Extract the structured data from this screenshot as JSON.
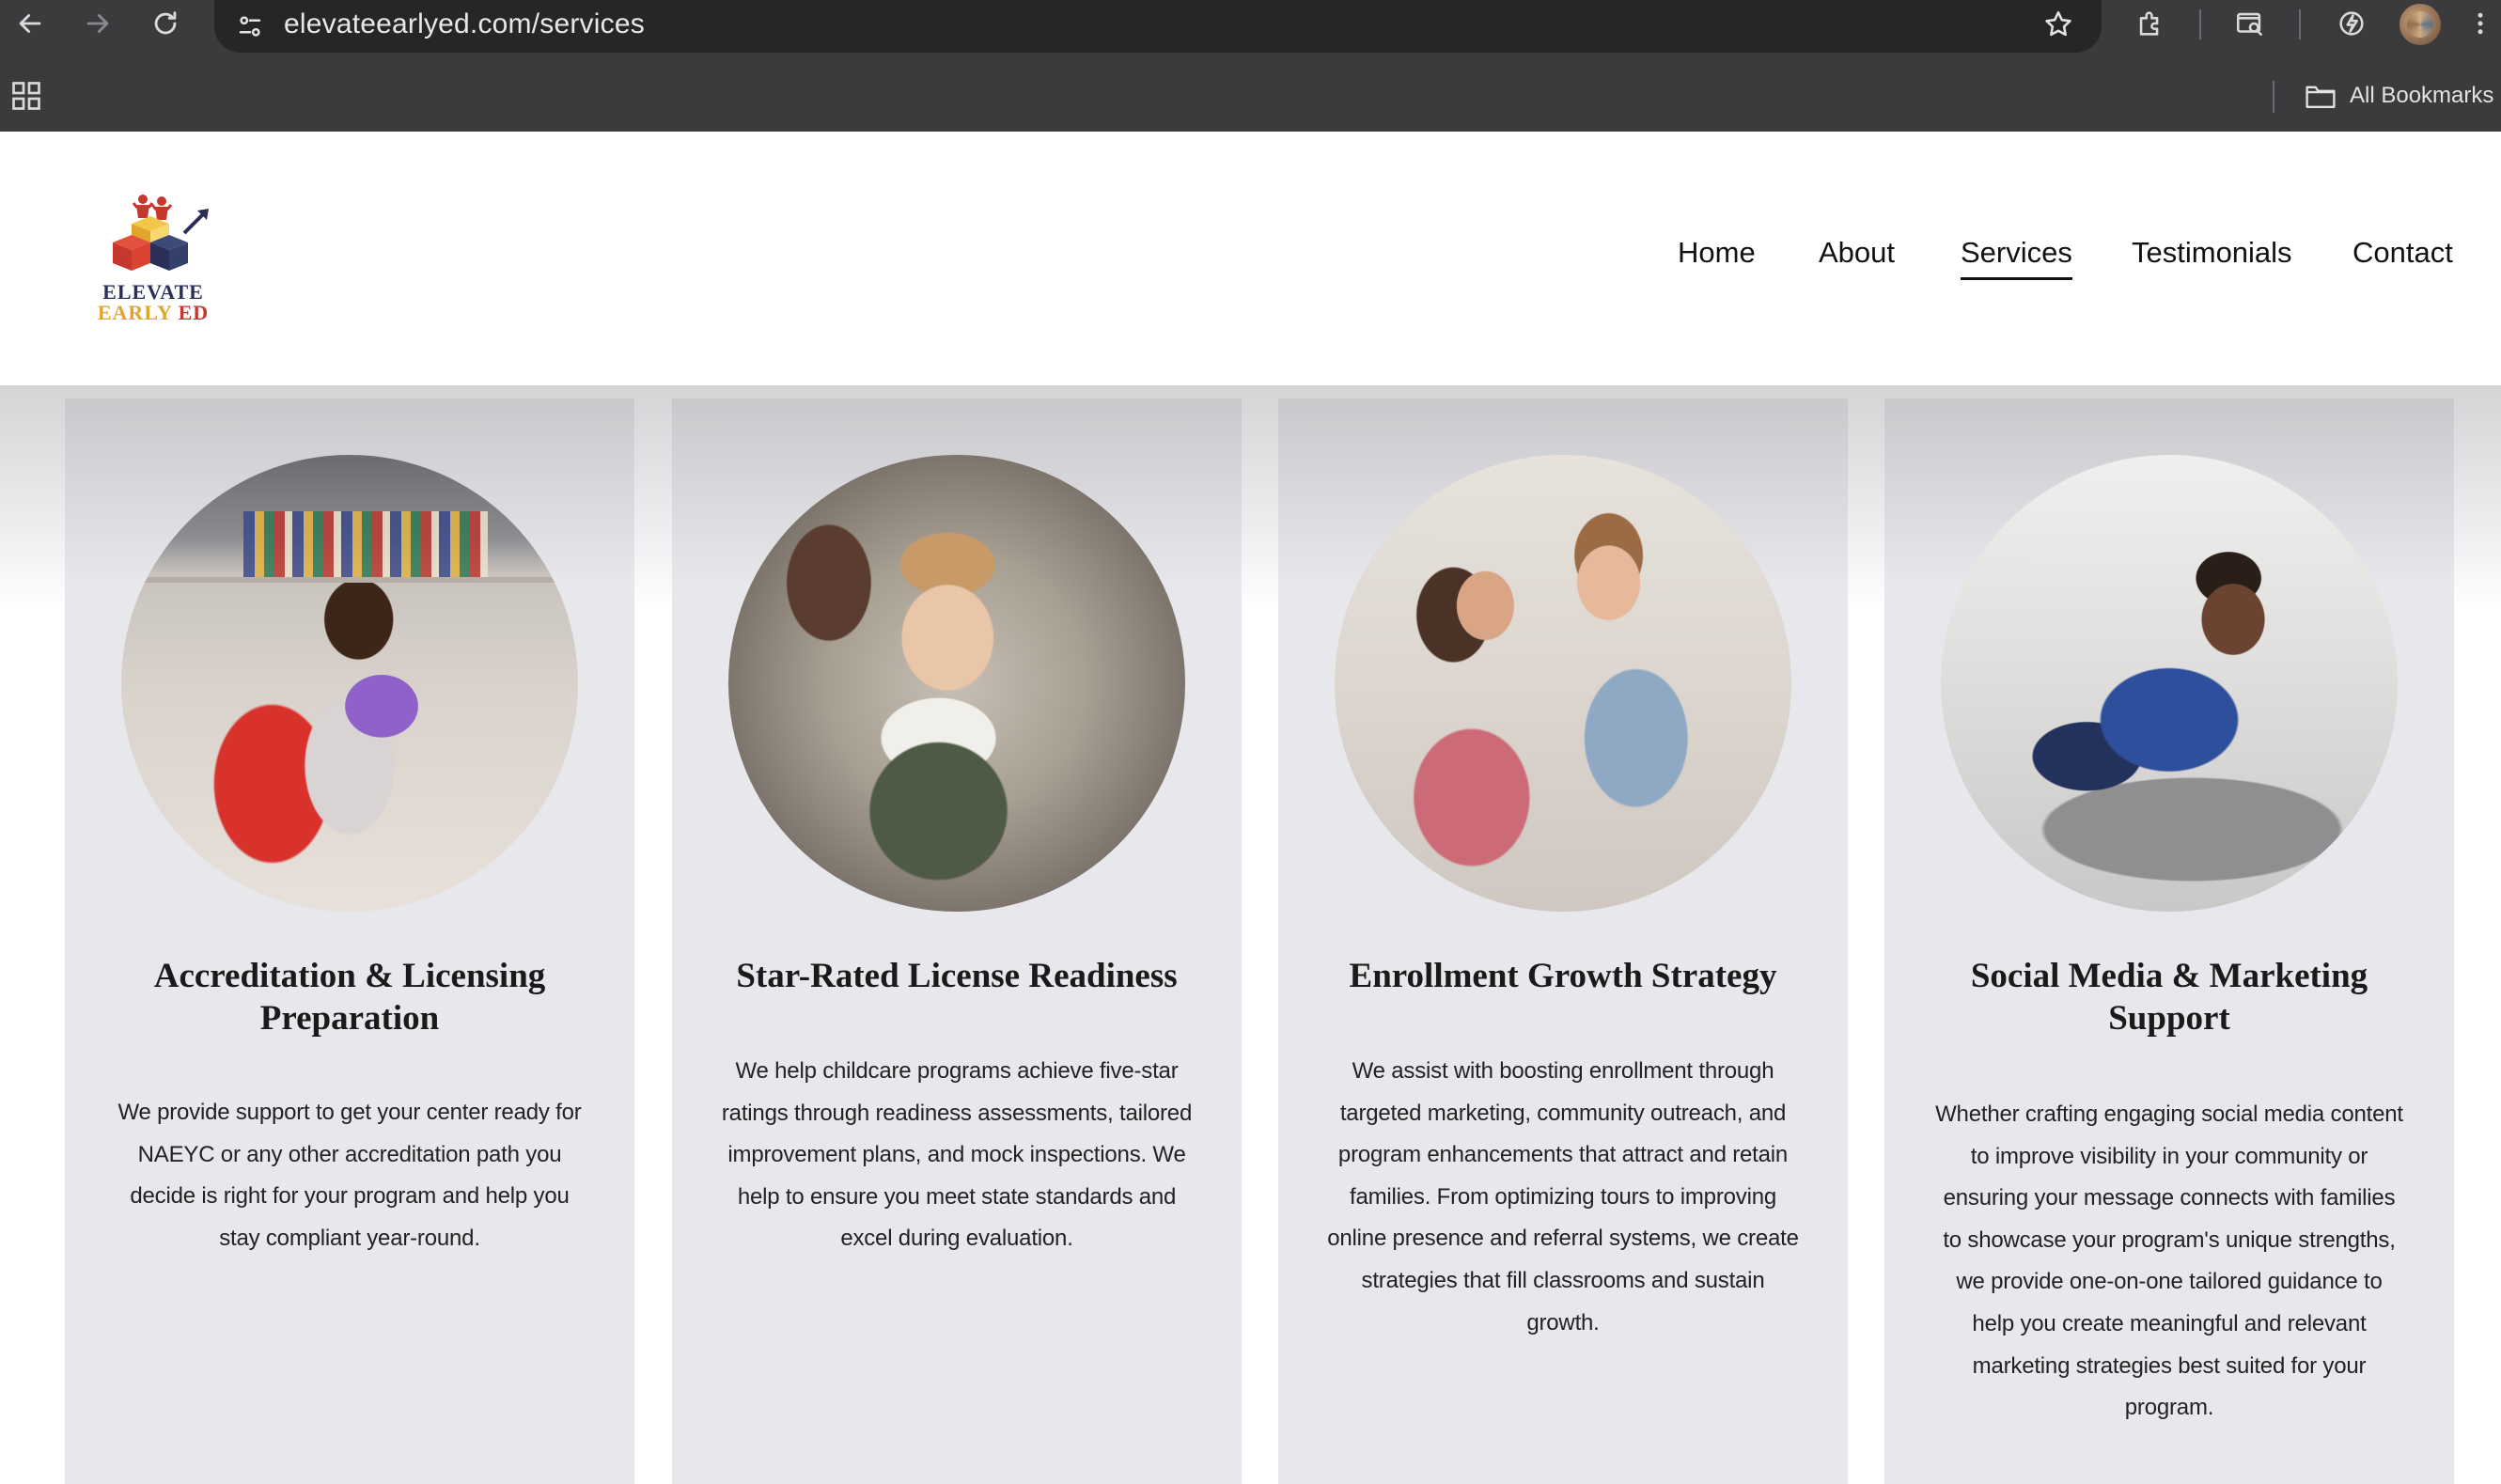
{
  "browser": {
    "url": "elevateearlyed.com/services",
    "bookmarks_label": "All Bookmarks",
    "icons": [
      "back-icon",
      "forward-icon",
      "reload-icon",
      "site-settings-icon",
      "star-icon",
      "extensions-icon",
      "tab-search-icon",
      "performance-icon",
      "avatar",
      "menu-icon",
      "apps-icon",
      "folder-icon"
    ]
  },
  "site": {
    "logo": {
      "line1": "ELEVATE",
      "line2_a": "EARLY",
      "line2_b": "ED"
    },
    "nav": [
      {
        "label": "Home"
      },
      {
        "label": "About"
      },
      {
        "label": "Services",
        "active": true
      },
      {
        "label": "Testimonials"
      },
      {
        "label": "Contact"
      }
    ]
  },
  "services": [
    {
      "title": "Accreditation & Licensing Preparation",
      "description": "We provide support to get your center ready for NAEYC or any other accreditation path you decide is right for your program and help you stay compliant year-round.",
      "image": "child-with-toy-camera"
    },
    {
      "title": "Star-Rated License Readiness",
      "description": "We help childcare programs achieve five-star ratings through readiness assessments, tailored improvement plans, and mock inspections. We help to ensure you meet state standards and excel during evaluation.",
      "image": "baby-crawling-in-tunnel"
    },
    {
      "title": "Enrollment Growth Strategy",
      "description": "We assist with boosting enrollment through targeted marketing, community outreach, and program enhancements that attract and retain families. From optimizing tours to improving online presence and referral systems, we create strategies that fill classrooms and sustain growth.",
      "image": "teacher-greeting-girl"
    },
    {
      "title": "Social Media & Marketing Support",
      "description": "Whether crafting engaging social media content to improve visibility in your community or ensuring your message connects with families to showcase your program's unique strengths, we provide one-on-one tailored guidance to help you create meaningful and relevant marketing strategies best suited for your program.",
      "image": "toddler-crawling-on-rug"
    }
  ],
  "colors": {
    "chrome_bg": "#3b3b3d",
    "omnibox_bg": "#262628",
    "card_bg": "#e8e7ec",
    "text": "#1a1a1a"
  }
}
